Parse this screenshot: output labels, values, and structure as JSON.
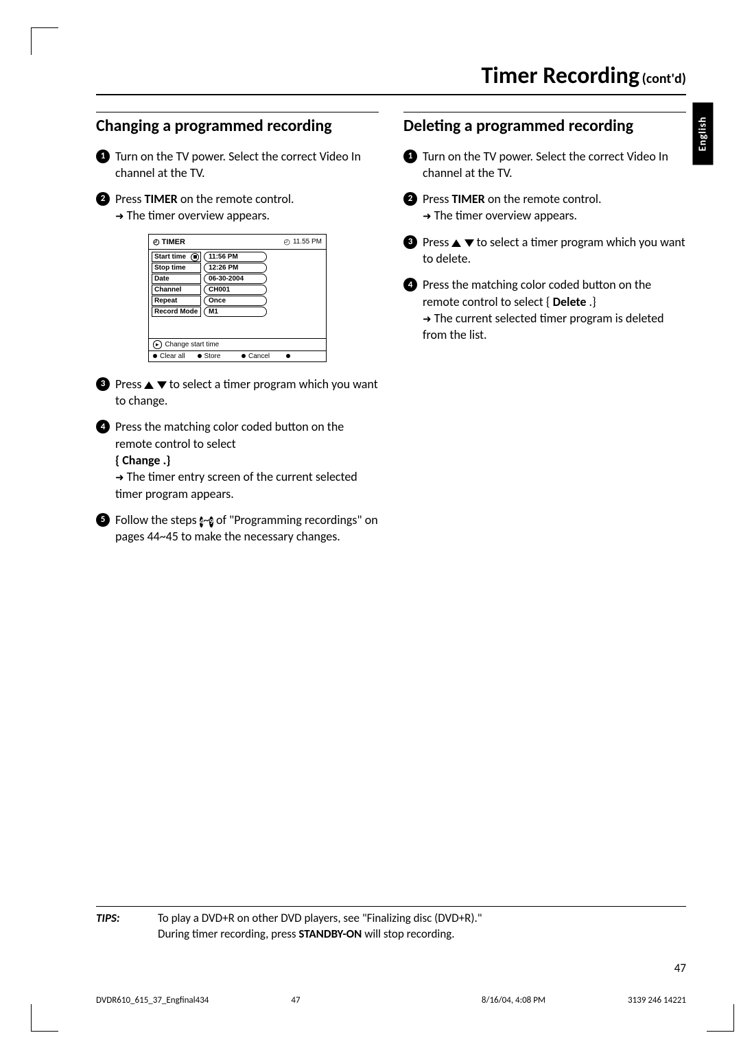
{
  "title": {
    "main": "Timer Recording",
    "suffix": "(cont'd)"
  },
  "language_tab": "English",
  "left": {
    "heading": "Changing a programmed recording",
    "steps": {
      "s1": "Turn on the TV power.  Select the correct Video In channel at the TV.",
      "s2a": "Press ",
      "s2b": "TIMER",
      "s2c": " on the remote control.",
      "s2d": "The timer overview appears.",
      "s3a": "Press ",
      "s3b": " to select a timer program which you want to change.",
      "s4a": "Press the matching color coded button on the remote control to select",
      "s4b": "{ Change .}",
      "s4c": "The timer entry screen of the current selected timer program appears.",
      "s5a": "Follow the steps ",
      "s5b": "~",
      "s5c": " of \"Programming recordings\" on pages 44~45 to make the necessary changes."
    }
  },
  "right": {
    "heading": "Deleting a programmed recording",
    "steps": {
      "s1": "Turn on the TV power.  Select the correct Video In channel at the TV.",
      "s2a": "Press ",
      "s2b": "TIMER",
      "s2c": " on the remote control.",
      "s2d": "The timer overview appears.",
      "s3a": "Press ",
      "s3b": " to select a timer program which you want to delete.",
      "s4a": "Press the matching color coded button on the remote control to select { ",
      "s4b": "Delete",
      "s4c": " .}",
      "s4d": "The current selected timer program is deleted from the list."
    }
  },
  "timer": {
    "title": "TIMER",
    "clock": "11.55 PM",
    "rows": {
      "start_time": {
        "label": "Start time",
        "value": "11:56 PM"
      },
      "stop_time": {
        "label": "Stop time",
        "value": "12:26 PM"
      },
      "date": {
        "label": "Date",
        "value": "06-30-2004"
      },
      "channel": {
        "label": "Channel",
        "value": "CH001"
      },
      "repeat": {
        "label": "Repeat",
        "value": "Once"
      },
      "record_mode": {
        "label": "Record Mode",
        "value": "M1"
      }
    },
    "hint_nav": "▸",
    "hint": "Change start time",
    "foot": {
      "clear": "Clear all",
      "store": "Store",
      "cancel": "Cancel"
    }
  },
  "tips": {
    "label": "TIPS:",
    "line1a": "To play a DVD+R on other DVD players, see \"Finalizing disc (DVD+R).\"",
    "line2a": "During timer recording, press ",
    "line2b": "STANDBY-ON",
    "line2c": " will stop recording."
  },
  "page_number": "47",
  "footer": {
    "file": "DVDR610_615_37_Engfinal434",
    "page": "47",
    "datetime": "8/16/04, 4:08 PM",
    "code": "3139 246 14221"
  }
}
